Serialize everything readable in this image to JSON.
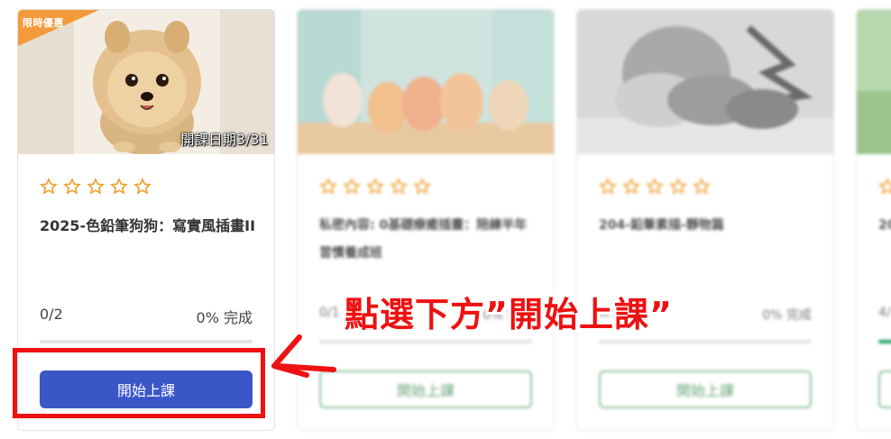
{
  "colors": {
    "primary_button": "#3a56c7",
    "outline_button": "#8dc39d",
    "progress_fill": "#26a269",
    "star": "#f0a030",
    "badge": "#f39a3a",
    "annotation": "#ee1111"
  },
  "courses": [
    {
      "badge": "限時優惠",
      "thumb_caption": "開課日期3/31",
      "rating_stars": 5,
      "rating_filled": 0,
      "title": "2025-色鉛筆狗狗：寫實風插畫II",
      "progress_count": "0/2",
      "progress_percent_label": "0% 完成",
      "progress_fraction": 0,
      "button_label": "開始上課",
      "icons": [
        "star-outline-icon"
      ]
    },
    {
      "title": "私密內容: 0基礎療癒插畫：陪練半年習慣養成班",
      "progress_count": "0/1",
      "progress_percent_label": "0% 完成",
      "progress_fraction": 0,
      "button_label": "開始上課"
    },
    {
      "title": "204-鉛筆素描-靜物篇",
      "progress_count": "0/1",
      "progress_percent_label": "0% 完成",
      "progress_fraction": 0,
      "button_label": "開始上課"
    },
    {
      "title": "20",
      "progress_count": "4/",
      "progress_fraction": 0.5,
      "button_label": ""
    }
  ],
  "annotation": {
    "text": "點選下方”開始上課”",
    "arrow_icon": "arrow-left-icon"
  }
}
